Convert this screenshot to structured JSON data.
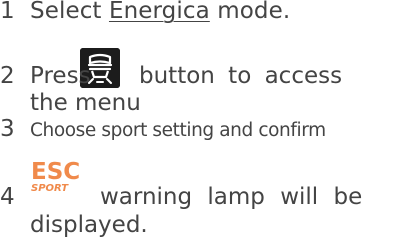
{
  "steps": [
    {
      "number": "1",
      "text_prefix": "Select ",
      "text_underlined": "Energica",
      "text_suffix": " mode."
    },
    {
      "number": "2",
      "press": "Press",
      "rest_line1": "button to access",
      "rest_line2": "the menu",
      "icon": "seat-button-icon"
    },
    {
      "number": "3",
      "text": "Choose sport setting and confirm"
    },
    {
      "number": "4",
      "lamp_top": "ESC",
      "lamp_bottom": "SPORT",
      "rest_line1": "warning lamp will be",
      "rest_line2": "displayed.",
      "icon": "esc-sport-warning-lamp-icon"
    }
  ],
  "colors": {
    "text": "#444444",
    "esc_orange": "#f08a4b",
    "icon_bg": "#1c1c1c"
  }
}
